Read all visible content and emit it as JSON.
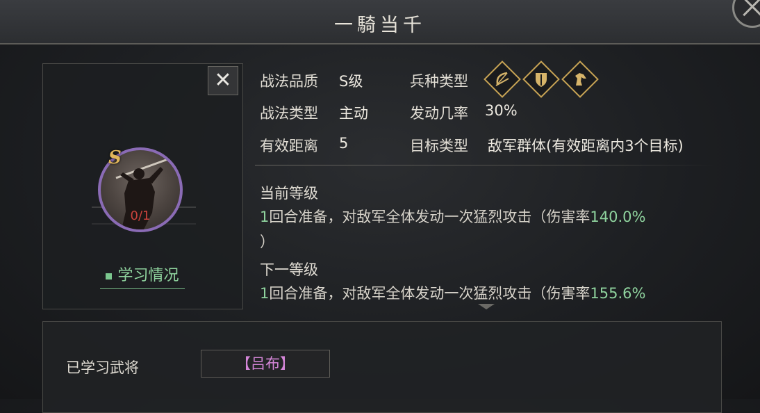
{
  "header": {
    "title": "一騎当千"
  },
  "card": {
    "close_glyph": "✕",
    "grade": "S",
    "level": "0/1",
    "learn_label": "学习情况"
  },
  "attributes": {
    "quality_label": "战法品质",
    "quality_value": "S级",
    "type_label": "战法类型",
    "type_value": "主动",
    "range_label": "有效距离",
    "range_value": "5",
    "unit_label": "兵种类型",
    "unit_icons": [
      "bow-icon",
      "shield-icon",
      "horse-icon"
    ],
    "rate_label": "发动几率",
    "rate_value": "30%",
    "target_label": "目标类型",
    "target_value": "敌军群体(有效距离内3个目标)"
  },
  "current": {
    "title": "当前等级",
    "prep": "1",
    "text": "回合准备，对敌军全体发动一次猛烈攻击（伤害率",
    "rate": "140.0%",
    "close": "）"
  },
  "next": {
    "title": "下一等级",
    "prep": "1",
    "text": "回合准备，对敌军全体发动一次猛烈攻击（伤害率",
    "rate": "155.6%"
  },
  "learned": {
    "label": "已学习武将",
    "hero": "【吕布】"
  },
  "colors": {
    "accent_green": "#8fd39e",
    "hero_pink": "#d486d8",
    "level_red": "#c9433c",
    "gold": "#c8a455"
  }
}
